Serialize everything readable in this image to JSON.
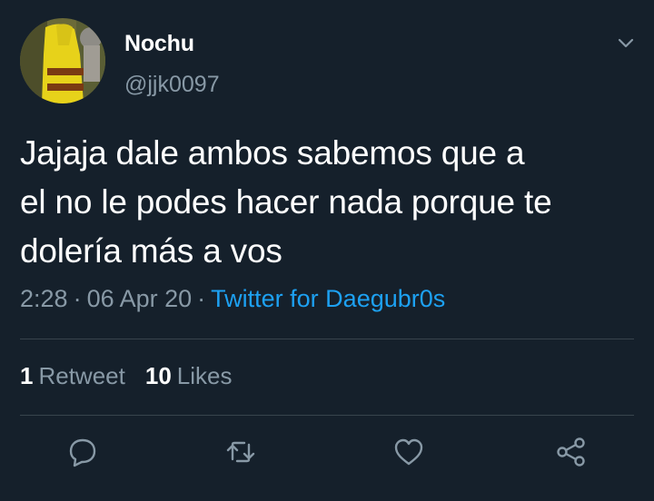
{
  "tweet": {
    "author_name": "Nochu",
    "author_handle": "@jjk0097",
    "text": "Jajaja dale ambos sabemos que a\nel no le podes hacer nada porque te\ndolería más a vos",
    "time": "2:28",
    "separator": "·",
    "date": "06 Apr 20",
    "source": "Twitter for Daegubr0s"
  },
  "stats": {
    "retweets_count": "1",
    "retweets_label": "Retweet",
    "likes_count": "10",
    "likes_label": "Likes"
  },
  "icons": {
    "caret": "chevron-down-icon",
    "reply": "reply-icon",
    "retweet": "retweet-icon",
    "like": "heart-icon",
    "share": "share-icon"
  },
  "colors": {
    "background": "#15202b",
    "text": "#ffffff",
    "secondary": "#8899a6",
    "link": "#1da1f2",
    "divider": "#38444d"
  }
}
